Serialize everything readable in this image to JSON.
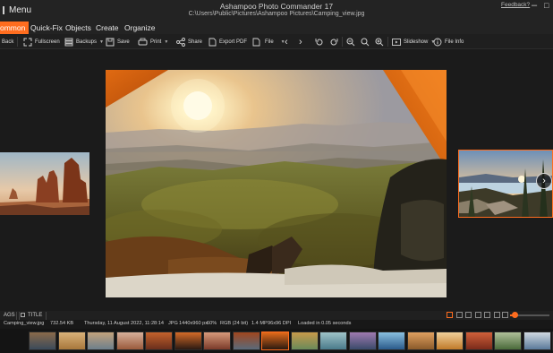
{
  "app": {
    "menu_label": "Menu",
    "title": "Ashampoo Photo Commander 17",
    "path": "C:\\Users\\Public\\Pictures\\Ashampoo Pictures\\Camping_view.jpg",
    "feedback_label": "Feedback?"
  },
  "tabs": [
    {
      "label": "ommon",
      "active": true
    },
    {
      "label": "Quick-Fix",
      "active": false
    },
    {
      "label": "Objects",
      "active": false
    },
    {
      "label": "Create",
      "active": false
    },
    {
      "label": "Organize",
      "active": false
    }
  ],
  "toolbar": {
    "back": "Back",
    "fullscreen": "Fullscreen",
    "backups": "Backups",
    "save": "Save",
    "print": "Print",
    "share": "Share",
    "export_pdf": "Export PDF",
    "file": "File",
    "slideshow": "Slideshow",
    "file_info": "File Info"
  },
  "tags_bar": {
    "tags_label": "AGS",
    "title_label": "TITLE",
    "zoom_level": 0.12
  },
  "status": {
    "filename": "Camping_view.jpg",
    "filesize": "732.54 KB",
    "date": "Thursday, 11 August 2022, 11:28:14",
    "format": "JPG",
    "dimensions": "1440x960 px",
    "zoom": "60%",
    "color": "RGB (24 bit)",
    "megapixels": "1.4 MP",
    "dpi": "96x96 DPI",
    "loaded": "Loaded in 0.05 seconds"
  },
  "colors": {
    "accent": "#ff6d1f",
    "background": "#1b1b1b",
    "toolbar": "#1f1f1f",
    "titlebar": "#232323"
  },
  "filmstrip": {
    "active_index": 8,
    "thumb_tones": [
      [
        "#3b4a5a",
        "#8a6a4a"
      ],
      [
        "#a7773b",
        "#d9b27a"
      ],
      [
        "#6d7f8c",
        "#c2a27c"
      ],
      [
        "#9a5a3c",
        "#d7b09a"
      ],
      [
        "#6a2e1c",
        "#c4622c"
      ],
      [
        "#2b1a12",
        "#d46a28"
      ],
      [
        "#7a3a2a",
        "#d79a7a"
      ],
      [
        "#5a6a7a",
        "#a0461e"
      ],
      [
        "#2a1a10",
        "#e46a1a"
      ],
      [
        "#6a8a5a",
        "#c79a4a"
      ],
      [
        "#4a7a8a",
        "#9fc3c8"
      ],
      [
        "#3a4a6a",
        "#a07ab0"
      ],
      [
        "#2a5a8a",
        "#8ac0e0"
      ],
      [
        "#8a5a2a",
        "#e0a060"
      ],
      [
        "#c07a2a",
        "#f0d09a"
      ],
      [
        "#7a2a1a",
        "#d0603a"
      ],
      [
        "#4a6a3a",
        "#b0c09a"
      ],
      [
        "#5a7a9a",
        "#cfd8e0"
      ],
      [
        "#3a6a8a",
        "#e0e0e0"
      ]
    ]
  }
}
